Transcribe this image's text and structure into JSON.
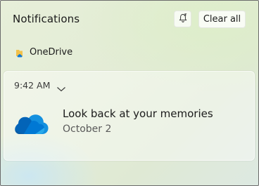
{
  "header": {
    "title": "Notifications",
    "focus_icon": "bell-zz-icon",
    "clear_label": "Clear all"
  },
  "group": {
    "app_name": "OneDrive",
    "app_icon": "onedrive-folder-icon"
  },
  "notification": {
    "time": "9:42 AM",
    "expand_icon": "chevron-down-icon",
    "icon": "onedrive-cloud-icon",
    "title": "Look back at your memories",
    "subtitle": "October 2"
  },
  "colors": {
    "onedrive_blue": "#0364b8",
    "onedrive_light": "#28a8ea"
  }
}
